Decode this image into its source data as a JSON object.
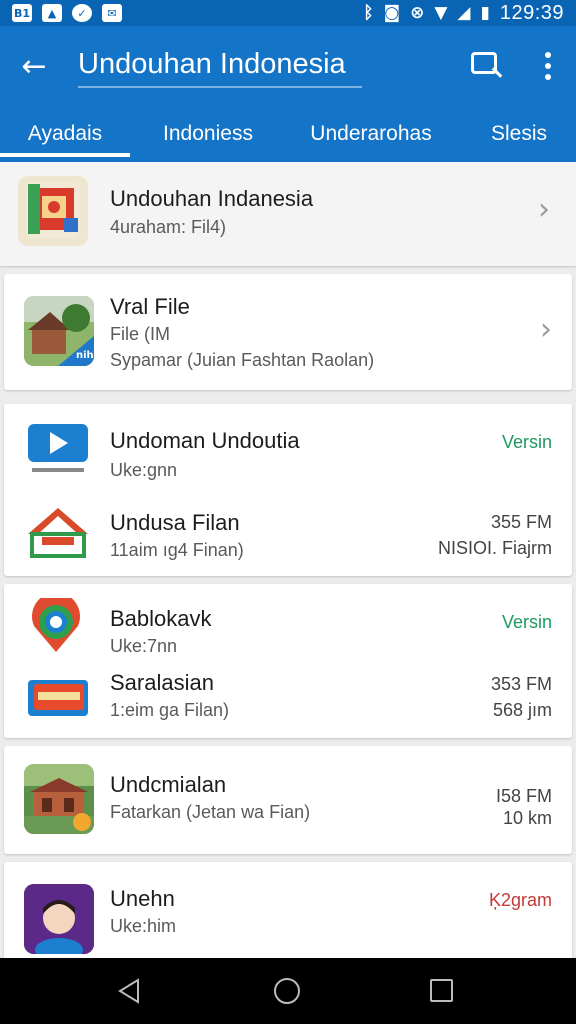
{
  "status_bar": {
    "left_icons": [
      "B1",
      "image-icon",
      "messenger-icon",
      "app-icon"
    ],
    "right_icons": [
      "bluetooth-icon",
      "camera-icon",
      "nfc-icon",
      "wifi-icon",
      "signal-icon",
      "battery-icon"
    ],
    "time": "129:39"
  },
  "app_bar": {
    "title": "Undouhan Indonesia"
  },
  "tabs": [
    "Ayadais",
    "Indoniess",
    "Underarohas",
    "Slesis"
  ],
  "accent_color": "#1474c8",
  "sections": [
    {
      "items": [
        {
          "title": "Undouhan Indanesia",
          "subtitle": "4uraham: Fil4)",
          "icon": "flag-app-icon"
        }
      ]
    },
    {
      "items": [
        {
          "title": "Vral File",
          "subtitle": "File (IM",
          "subtitle2": "Sypamar (Juian Fashtan Raolan)",
          "icon": "village-photo-icon"
        }
      ]
    },
    {
      "items": [
        {
          "title": "Undoman Undoutia",
          "subtitle": "Uke:gnn",
          "right": "Versin",
          "icon": "play-store-icon"
        },
        {
          "title": "Undusa Filan",
          "subtitle": "11aim ıg4 Finan)",
          "right": "355 FM",
          "right2": "NISIOI. Fiajrm",
          "icon": "house-app-icon"
        }
      ]
    },
    {
      "items": [
        {
          "title": "Bablokavk",
          "subtitle": "Uke:7nn",
          "right": "Versin",
          "icon": "map-pin-icon"
        },
        {
          "title": "Saralasian",
          "subtitle": "1:eim ga Filan)",
          "right": "353 FM",
          "right2": "568 jım",
          "icon": "ticket-icon"
        }
      ]
    },
    {
      "items": [
        {
          "title": "Undcmialan",
          "subtitle": "Fatarkan (Jetan wa Fian)",
          "right": "I58 FM",
          "right2": "10 km",
          "icon": "building-photo-icon"
        }
      ]
    },
    {
      "items": [
        {
          "title": "Unehn",
          "subtitle": "Uke:him",
          "right": "Ķ2gram",
          "icon": "avatar-app-icon"
        }
      ]
    }
  ],
  "nav_bar": [
    "back-icon",
    "home-icon",
    "recents-icon"
  ]
}
